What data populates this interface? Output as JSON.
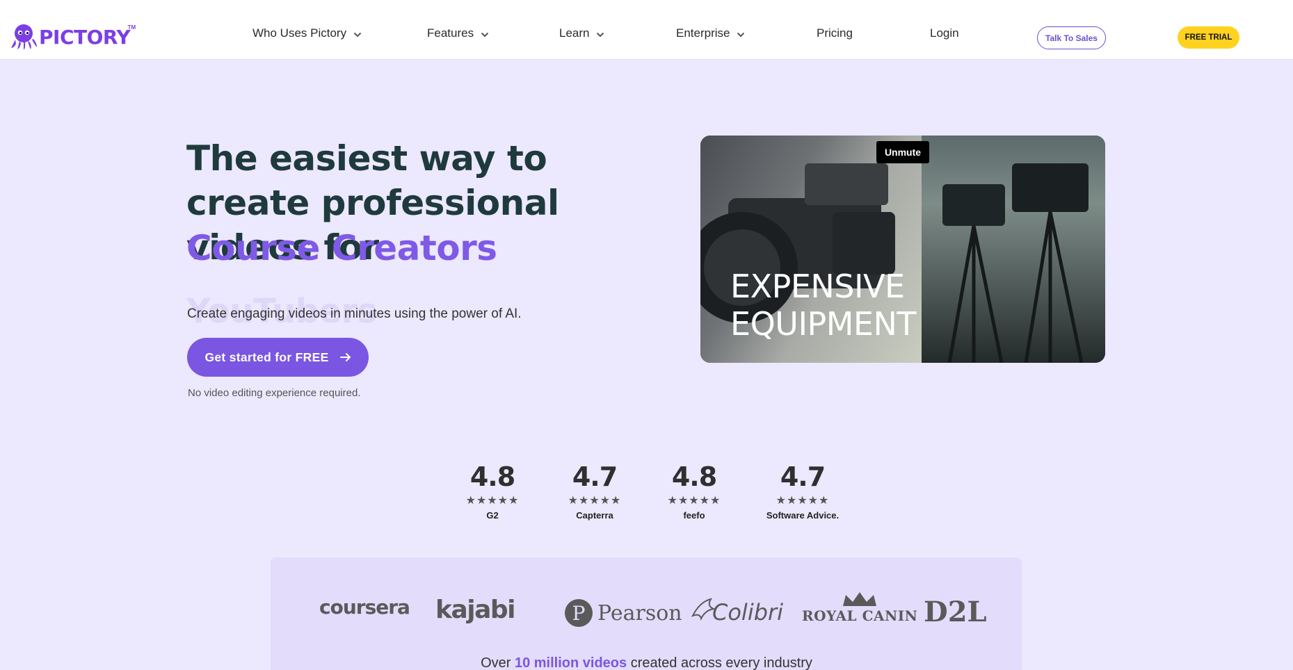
{
  "header": {
    "logo_text": "PICTORY",
    "logo_tm": "TM",
    "nav": [
      {
        "label": "Who Uses Pictory",
        "has_dropdown": true
      },
      {
        "label": "Features",
        "has_dropdown": true
      },
      {
        "label": "Learn",
        "has_dropdown": true
      },
      {
        "label": "Enterprise",
        "has_dropdown": true
      },
      {
        "label": "Pricing",
        "has_dropdown": false
      },
      {
        "label": "Login",
        "has_dropdown": false
      }
    ],
    "talk_to_sales": "Talk To Sales",
    "free_trial": "FREE TRIAL"
  },
  "hero": {
    "title": "The easiest way to create professional videos for",
    "rotating_word": "Course Creators",
    "rotating_word_next": "YouTubers",
    "subtitle": "Create engaging videos in minutes using the power of AI.",
    "cta": "Get started for FREE",
    "note": "No video editing experience required."
  },
  "video": {
    "unmute_label": "Unmute",
    "caption_line1": "EXPENSIVE",
    "caption_line2": "EQUIPMENT"
  },
  "ratings": [
    {
      "value": "4.8",
      "stars": "★★★★★",
      "source": "G2"
    },
    {
      "value": "4.7",
      "stars": "★★★★★",
      "source": "Capterra"
    },
    {
      "value": "4.8",
      "stars": "★★★★★",
      "source": "feefo"
    },
    {
      "value": "4.7",
      "stars": "★★★★★",
      "source": "Software Advice."
    }
  ],
  "brands": [
    "coursera",
    "kajabi",
    "Pearson",
    "Colibri",
    "ROYAL CANIN",
    "D2L"
  ],
  "stats": {
    "prefix": "Over",
    "highlight": "10 million videos",
    "suffix": "created across every industry"
  },
  "colors": {
    "brand": "#7b3fe4",
    "accent": "#7a56e2",
    "background": "#ece8fd",
    "trial_button": "#ffd21f"
  }
}
